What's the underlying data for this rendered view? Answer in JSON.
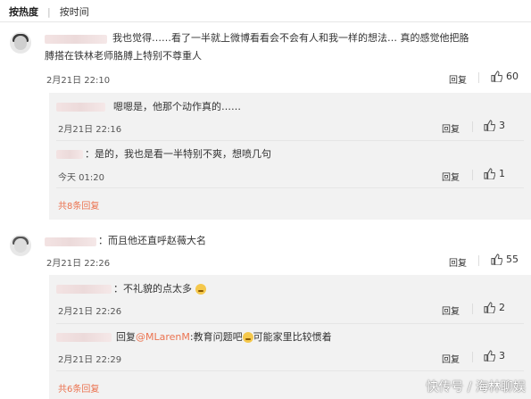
{
  "sort": {
    "hot": "按热度",
    "time": "按时间"
  },
  "comment1": {
    "text_a": "我也觉得……看了一半就上微博看看会不会有人和我一样的想法… 真的感觉他把胳",
    "text_b": "膊搭在铁林老师胳膊上特别不尊重人",
    "time": "2月21日 22:10",
    "reply": "回复",
    "likes": "60",
    "replies": [
      {
        "text": "嗯嗯是，他那个动作真的……",
        "time": "2月21日 22:16",
        "reply": "回复",
        "likes": "3"
      },
      {
        "text": "：是的，我也是看一半特别不爽，想喷几句",
        "time": "今天 01:20",
        "reply": "回复",
        "likes": "1"
      }
    ],
    "more": "共8条回复"
  },
  "comment2": {
    "text": "：而且他还直呼赵薇大名",
    "time": "2月21日 22:26",
    "reply": "回复",
    "likes": "55",
    "replies": [
      {
        "text": "：不礼貌的点太多",
        "time": "2月21日 22:26",
        "reply": "回复",
        "likes": "2"
      },
      {
        "prefix": "回复",
        "mention": "@MLarenM",
        "text_a": ":教育问题吧",
        "text_b": "可能家里比较惯着",
        "time": "2月21日 22:29",
        "reply": "回复",
        "likes": "3"
      }
    ],
    "more": "共6条回复"
  },
  "watermark": "快传号 / 海林聊娱",
  "colors": {
    "link": "#eb7350",
    "reply_bg": "#f2f2f2"
  }
}
